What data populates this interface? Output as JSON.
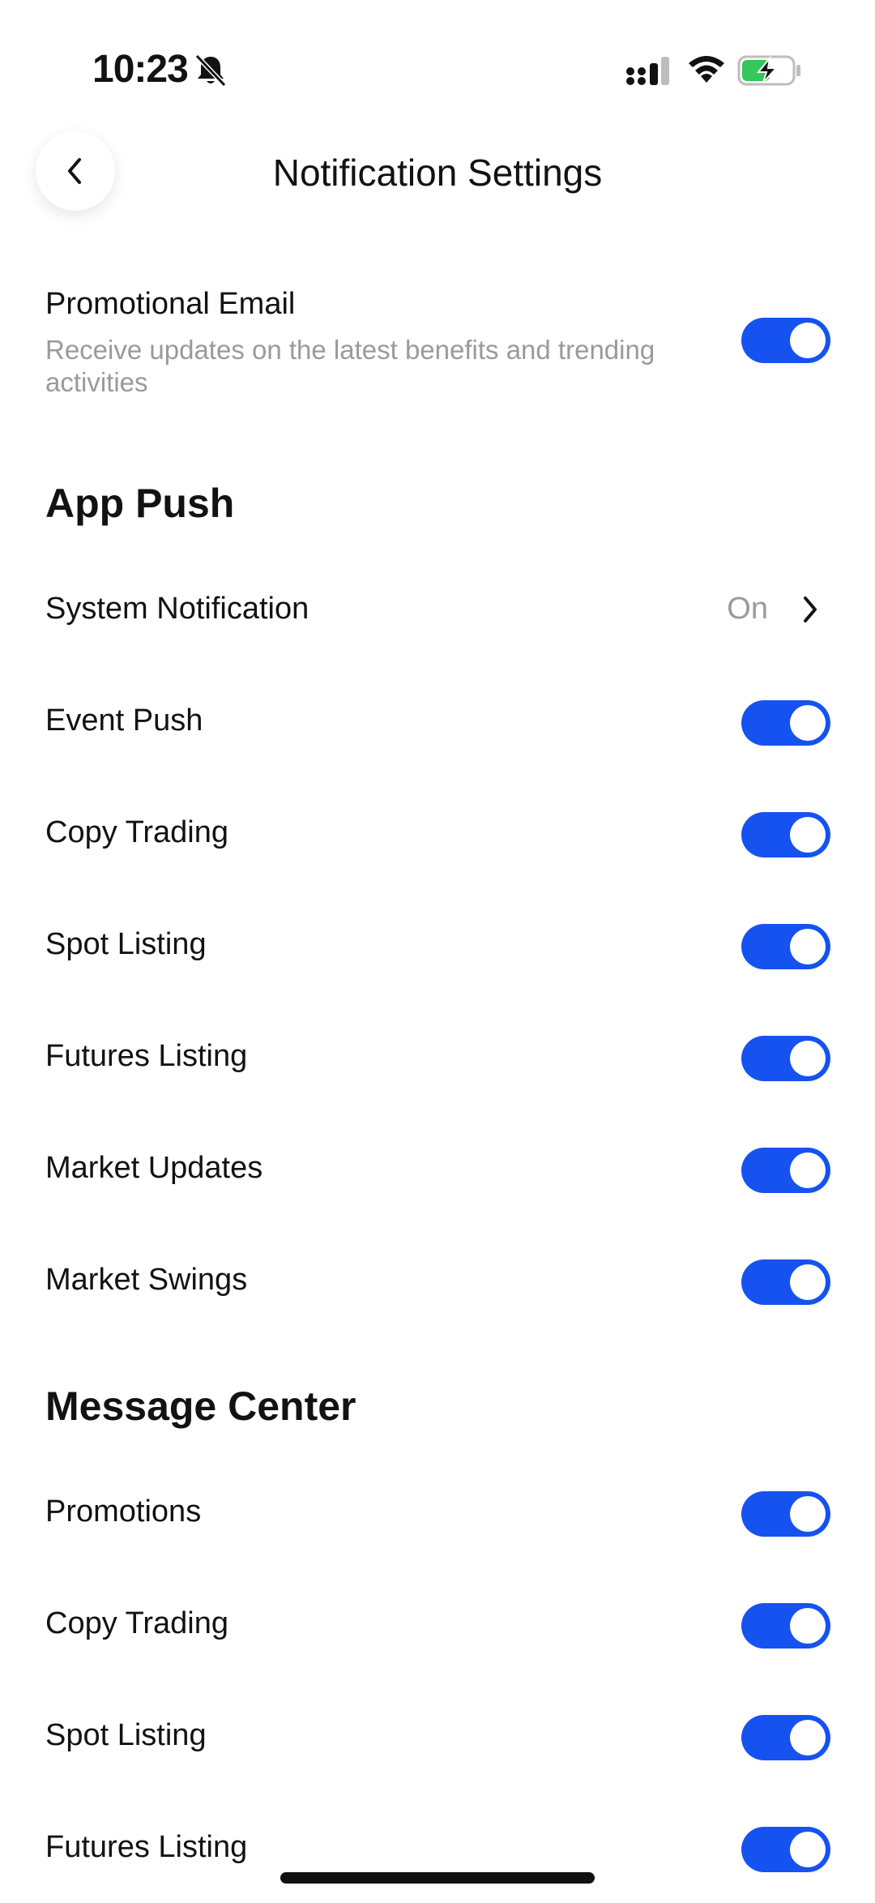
{
  "status_bar": {
    "time": "10:23"
  },
  "header": {
    "title": "Notification Settings"
  },
  "promo_email": {
    "label": "Promotional Email",
    "description": "Receive updates on the latest benefits and trending activities",
    "enabled": true
  },
  "app_push": {
    "heading": "App Push",
    "system_notification": {
      "label": "System Notification",
      "value": "On"
    },
    "items": [
      {
        "label": "Event Push",
        "enabled": true
      },
      {
        "label": "Copy Trading",
        "enabled": true
      },
      {
        "label": "Spot Listing",
        "enabled": true
      },
      {
        "label": "Futures Listing",
        "enabled": true
      },
      {
        "label": "Market Updates",
        "enabled": true
      },
      {
        "label": "Market Swings",
        "enabled": true
      }
    ]
  },
  "message_center": {
    "heading": "Message Center",
    "items": [
      {
        "label": "Promotions",
        "enabled": true
      },
      {
        "label": "Copy Trading",
        "enabled": true
      },
      {
        "label": "Spot Listing",
        "enabled": true
      },
      {
        "label": "Futures Listing",
        "enabled": true
      }
    ]
  },
  "colors": {
    "accent": "#1652f0",
    "text": "#121212",
    "muted": "#9a9a9a"
  }
}
